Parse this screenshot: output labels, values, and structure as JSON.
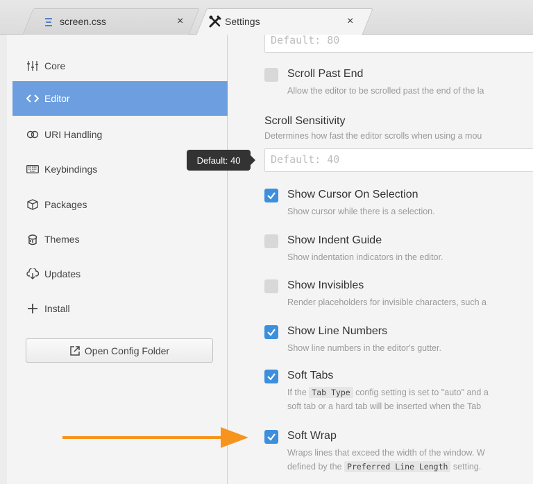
{
  "tabs": [
    {
      "label": "screen.css",
      "icon": "css-file-icon"
    },
    {
      "label": "Settings",
      "icon": "tools-icon"
    }
  ],
  "sidebar": {
    "items": [
      {
        "label": "Core",
        "icon": "sliders-icon"
      },
      {
        "label": "Editor",
        "icon": "code-icon",
        "active": true
      },
      {
        "label": "URI Handling",
        "icon": "link-icon"
      },
      {
        "label": "Keybindings",
        "icon": "keyboard-icon"
      },
      {
        "label": "Packages",
        "icon": "package-icon"
      },
      {
        "label": "Themes",
        "icon": "paint-bucket-icon"
      },
      {
        "label": "Updates",
        "icon": "cloud-download-icon"
      },
      {
        "label": "Install",
        "icon": "plus-icon"
      }
    ],
    "open_config_label": "Open Config Folder"
  },
  "main": {
    "prev_input_placeholder": "Default: 80",
    "scroll_past_end": {
      "title": "Scroll Past End",
      "desc": "Allow the editor to be scrolled past the end of the la",
      "checked": false
    },
    "scroll_sensitivity": {
      "title": "Scroll Sensitivity",
      "desc": "Determines how fast the editor scrolls when using a mou",
      "placeholder": "Default: 40",
      "tooltip": "Default: 40"
    },
    "show_cursor_on_selection": {
      "title": "Show Cursor On Selection",
      "desc": "Show cursor while there is a selection.",
      "checked": true
    },
    "show_indent_guide": {
      "title": "Show Indent Guide",
      "desc": "Show indentation indicators in the editor.",
      "checked": false
    },
    "show_invisibles": {
      "title": "Show Invisibles",
      "desc": "Render placeholders for invisible characters, such a",
      "checked": false
    },
    "show_line_numbers": {
      "title": "Show Line Numbers",
      "desc": "Show line numbers in the editor's gutter.",
      "checked": true
    },
    "soft_tabs": {
      "title": "Soft Tabs",
      "desc_before": "If the",
      "desc_code": "Tab Type",
      "desc_after": "config setting is set to \"auto\" and a",
      "desc_line2": "soft tab or a hard tab will be inserted when the Tab",
      "checked": true
    },
    "soft_wrap": {
      "title": "Soft Wrap",
      "desc_line1": "Wraps lines that exceed the width of the window. W",
      "desc_line2_before": "defined by the",
      "desc_code": "Preferred Line Length",
      "desc_line2_after": "setting.",
      "checked": true
    }
  },
  "colors": {
    "accent": "#6d9ee0",
    "checkbox_on": "#3d8fdc",
    "arrow": "#f7941d"
  }
}
